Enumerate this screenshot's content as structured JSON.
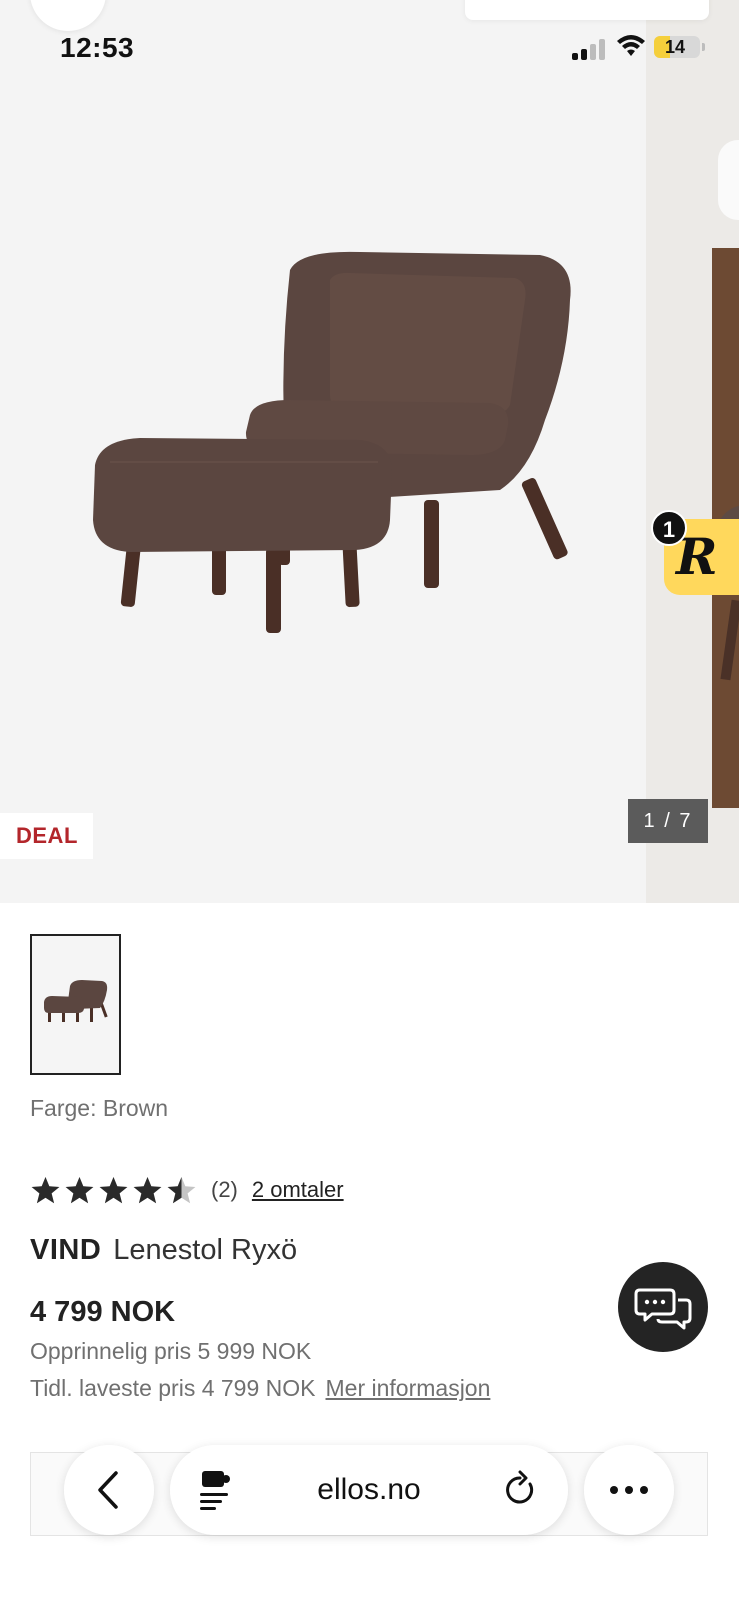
{
  "status_bar": {
    "time": "12:53",
    "battery": "14",
    "battery_level": 0.14
  },
  "gallery": {
    "deal_badge": "DEAL",
    "counter": "1 / 7",
    "alt": "Lenestol Ryxö"
  },
  "ryze_widget": {
    "letter": "R",
    "count": "1"
  },
  "product": {
    "color_label": "Farge: Brown",
    "rating": {
      "value": 4.5,
      "max": 5,
      "count_text": "(2)",
      "reviews_link": "2 omtaler"
    },
    "brand": "VIND",
    "name": "Lenestol Ryxö",
    "price": "4 799 NOK",
    "original_price": "Opprinnelig pris 5 999 NOK",
    "lowest_price": "Tidl. laveste pris 4 799 NOK",
    "more_info": "Mer informasjon"
  },
  "browser_bar": {
    "url": "ellos.no"
  },
  "colors": {
    "deal_red": "#b3262b",
    "counter_bg": "#5b5b5b",
    "ryze_yellow": "#ffd85c",
    "chair_brown": "#5b4640",
    "chat_bg": "#242424",
    "text_gray": "#707070"
  },
  "icons": {
    "back": "chevron-left-icon",
    "extension": "extension-icon",
    "reload": "reload-icon",
    "more": "ellipsis-icon",
    "chat": "chat-bubbles-icon",
    "star": "star-icon"
  }
}
